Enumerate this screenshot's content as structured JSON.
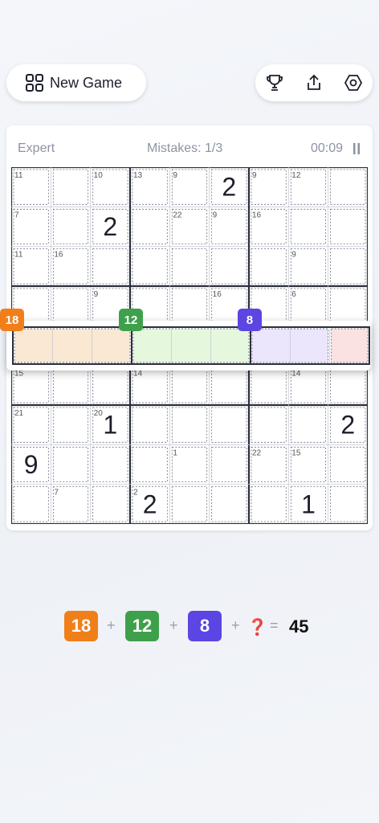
{
  "new_game": {
    "label": "New Game"
  },
  "toolbar": {
    "icons": [
      "trophy-icon",
      "share-icon",
      "settings-icon"
    ]
  },
  "status": {
    "difficulty": "Expert",
    "mistakes": "Mistakes: 1/3",
    "timer": "00:09"
  },
  "board": {
    "digits": [
      [
        0,
        0,
        0,
        0,
        0,
        2,
        0,
        0,
        0
      ],
      [
        0,
        0,
        2,
        0,
        0,
        0,
        0,
        0,
        0
      ],
      [
        0,
        0,
        0,
        0,
        0,
        0,
        0,
        0,
        0
      ],
      [
        0,
        0,
        0,
        0,
        0,
        0,
        0,
        0,
        0
      ],
      [
        0,
        0,
        0,
        0,
        0,
        0,
        0,
        0,
        0
      ],
      [
        0,
        0,
        0,
        0,
        0,
        0,
        0,
        0,
        0
      ],
      [
        0,
        0,
        1,
        0,
        0,
        0,
        0,
        0,
        2
      ],
      [
        9,
        0,
        0,
        0,
        0,
        0,
        0,
        0,
        0
      ],
      [
        0,
        0,
        0,
        2,
        0,
        0,
        0,
        1,
        0
      ]
    ],
    "cage_sums": [
      {
        "r": 0,
        "c": 0,
        "s": "11"
      },
      {
        "r": 0,
        "c": 2,
        "s": "10"
      },
      {
        "r": 0,
        "c": 3,
        "s": "13"
      },
      {
        "r": 0,
        "c": 4,
        "s": "9"
      },
      {
        "r": 0,
        "c": 6,
        "s": "9"
      },
      {
        "r": 0,
        "c": 7,
        "s": "12"
      },
      {
        "r": 1,
        "c": 0,
        "s": "7"
      },
      {
        "r": 1,
        "c": 4,
        "s": "22"
      },
      {
        "r": 1,
        "c": 5,
        "s": "9"
      },
      {
        "r": 1,
        "c": 6,
        "s": "16"
      },
      {
        "r": 2,
        "c": 0,
        "s": "11"
      },
      {
        "r": 2,
        "c": 1,
        "s": "16"
      },
      {
        "r": 2,
        "c": 7,
        "s": "9"
      },
      {
        "r": 3,
        "c": 2,
        "s": "9"
      },
      {
        "r": 3,
        "c": 5,
        "s": "16"
      },
      {
        "r": 3,
        "c": 7,
        "s": "6"
      },
      {
        "r": 5,
        "c": 0,
        "s": "15"
      },
      {
        "r": 5,
        "c": 3,
        "s": "14"
      },
      {
        "r": 5,
        "c": 7,
        "s": "14"
      },
      {
        "r": 6,
        "c": 0,
        "s": "21"
      },
      {
        "r": 6,
        "c": 2,
        "s": "20"
      },
      {
        "r": 7,
        "c": 4,
        "s": "1"
      },
      {
        "r": 7,
        "c": 6,
        "s": "22"
      },
      {
        "r": 7,
        "c": 7,
        "s": "15"
      },
      {
        "r": 8,
        "c": 1,
        "s": "7"
      },
      {
        "r": 8,
        "c": 3,
        "s": "2"
      }
    ],
    "highlight_row": [
      {
        "cols": [
          0,
          1,
          2
        ],
        "sum": "18",
        "color": "#f07f1a",
        "fill": "#fae8d3"
      },
      {
        "cols": [
          3,
          4,
          5
        ],
        "sum": "12",
        "color": "#3fa04c",
        "fill": "#e5f7dd"
      },
      {
        "cols": [
          6,
          7
        ],
        "sum": "8",
        "color": "#5b45e3",
        "fill": "#ebe6fb"
      },
      {
        "cols": [
          8
        ],
        "sum": "",
        "color": "#d62b2b",
        "fill": "#fbe2e2"
      }
    ]
  },
  "equation": {
    "terms": [
      {
        "value": "18",
        "color": "#f07f1a"
      },
      {
        "value": "12",
        "color": "#3fa04c"
      },
      {
        "value": "8",
        "color": "#5b45e3"
      }
    ],
    "plus": "+",
    "unknown": "❓",
    "equals": "=",
    "total": "45"
  }
}
